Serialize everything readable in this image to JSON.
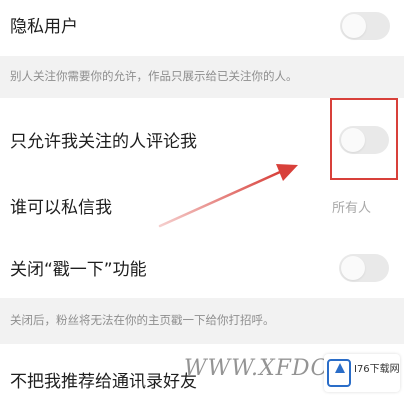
{
  "settings": {
    "private_account": {
      "label": "隐私用户",
      "enabled": false,
      "description": "别人关注你需要你的允许，作品只展示给已关注你的人。"
    },
    "comment_following_only": {
      "label": "只允许我关注的人评论我",
      "enabled": false
    },
    "who_can_message": {
      "label": "谁可以私信我",
      "value": "所有人"
    },
    "disable_poke": {
      "label": "关闭“戳一下”功能",
      "enabled": false,
      "description": "关闭后，粉丝将无法在你的主页戳一下给你打招呼。"
    },
    "no_contact_recommend": {
      "label": "不把我推荐给通讯录好友"
    }
  },
  "annotation": {
    "highlight_color": "#d8403a",
    "arrow_color": "#d8403a"
  },
  "watermark": {
    "text": "WWW.XFDOWN",
    "logo_text": "I76下载网"
  },
  "colors": {
    "background": "#ffffff",
    "section_gray": "#f2f2f2",
    "toggle_off": "#e9e9e9",
    "text_primary": "#1e1e1e",
    "text_secondary": "#8e8e8e"
  },
  "icons": {
    "arrow": "red-arrow-icon",
    "logo": "site-logo-icon"
  }
}
